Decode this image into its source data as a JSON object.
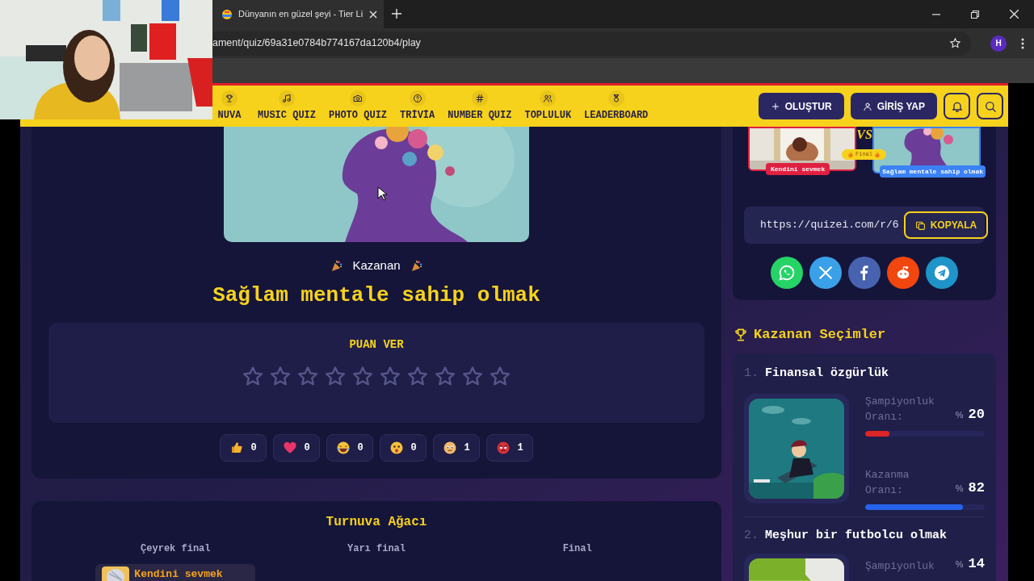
{
  "browser": {
    "tab_title": "Dünyanın en güzel şeyi - Tier Li",
    "address": "ament/quiz/69a31e0784b774167da120b4/play",
    "profile_initial": "H"
  },
  "nav": {
    "items": [
      {
        "label": "NUVA",
        "kind": "trophy"
      },
      {
        "label": "MUSIC QUIZ",
        "kind": "music"
      },
      {
        "label": "PHOTO QUIZ",
        "kind": "camera"
      },
      {
        "label": "TRİVİA",
        "kind": "question"
      },
      {
        "label": "NUMBER QUIZ",
        "kind": "hash"
      },
      {
        "label": "TOPLULUK",
        "kind": "users"
      },
      {
        "label": "LEADERBOARD",
        "kind": "medal"
      }
    ],
    "buttons": [
      {
        "label": "OLUŞTUR",
        "kind": "plus"
      },
      {
        "label": "GİRİŞ YAP",
        "kind": "user"
      }
    ]
  },
  "winner": {
    "caption": "Kazanan",
    "title": "Sağlam mentale sahip olmak"
  },
  "rating": {
    "title": "PUAN VER",
    "stars": 0
  },
  "reactions": [
    {
      "kind": "like",
      "count": "0"
    },
    {
      "kind": "heart",
      "count": "0"
    },
    {
      "kind": "laugh",
      "count": "0"
    },
    {
      "kind": "wow",
      "count": "0"
    },
    {
      "kind": "sad",
      "count": "1"
    },
    {
      "kind": "angry",
      "count": "1"
    }
  ],
  "final_preview": {
    "vs": "VS",
    "badge": "Final",
    "left_label": "Kendini sevmek",
    "right_label": "Sağlam mentale sahip olmak"
  },
  "share": {
    "link": "https://quizei.com/r/6",
    "copy_button": "KOPYALA",
    "networks": [
      {
        "kind": "whatsapp"
      },
      {
        "kind": "x"
      },
      {
        "kind": "facebook"
      },
      {
        "kind": "reddit"
      },
      {
        "kind": "telegram"
      }
    ]
  },
  "winners": {
    "title": "Kazanan Seçimler",
    "items": [
      {
        "rank": "1.",
        "name": "Finansal özgürlük",
        "stats": [
          {
            "label": "Şampiyonluk Oranı:",
            "unit": "%",
            "value": "20",
            "level": 0.2,
            "color": "#dc2626"
          },
          {
            "label": "Kazanma Oranı:",
            "unit": "%",
            "value": "82",
            "level": 0.82,
            "color": "#2563eb"
          }
        ]
      },
      {
        "rank": "2.",
        "name": "Meşhur bir futbolcu olmak",
        "stats": [
          {
            "label": "Şampiyonluk",
            "unit": "%",
            "value": "14"
          }
        ]
      }
    ]
  },
  "bracket": {
    "title": "Turnuva Ağacı",
    "rounds": [
      {
        "name": "Çeyrek final",
        "entries": [
          {
            "name": "Kendini sevmek"
          }
        ]
      },
      {
        "name": "Yarı final"
      },
      {
        "name": "Final"
      }
    ]
  }
}
